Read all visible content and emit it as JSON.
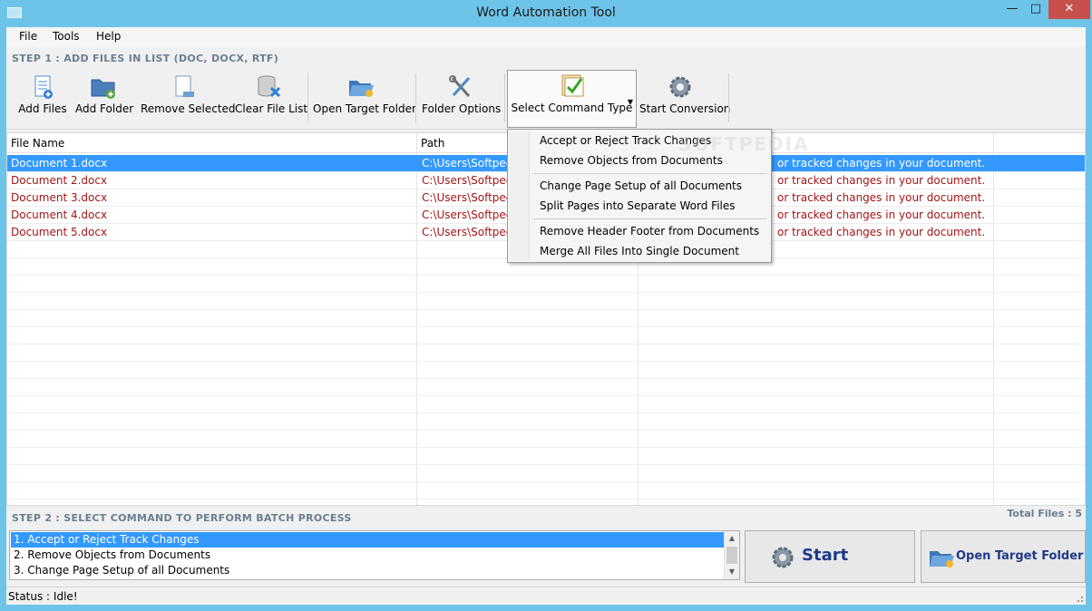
{
  "window": {
    "title": "Word Automation Tool",
    "minimize": "—",
    "maximize": "□",
    "close": "✕"
  },
  "menu": {
    "items": [
      "File",
      "Tools",
      "Help"
    ]
  },
  "step1_label": "STEP 1 : ADD FILES IN LIST (DOC, DOCX, RTF)",
  "toolbar": {
    "add_files": "Add Files",
    "add_folder": "Add Folder",
    "remove_selected": "Remove Selected",
    "clear_file_list": "Clear File List",
    "open_target_folder": "Open Target Folder",
    "folder_options": "Folder Options",
    "select_command_type": "Select Command Type",
    "start_conversion": "Start Conversion"
  },
  "grid": {
    "columns": [
      "File Name",
      "Path"
    ],
    "rows": [
      {
        "name": "Document 1.docx",
        "path": "C:\\Users\\Softpedia",
        "desc": "or tracked changes in your document."
      },
      {
        "name": "Document 2.docx",
        "path": "C:\\Users\\Softpedia",
        "desc": "or tracked changes in your document."
      },
      {
        "name": "Document 3.docx",
        "path": "C:\\Users\\Softpedia",
        "desc": "or tracked changes in your document."
      },
      {
        "name": "Document 4.docx",
        "path": "C:\\Users\\Softpedia",
        "desc": "or tracked changes in your document."
      },
      {
        "name": "Document 5.docx",
        "path": "C:\\Users\\Softpedia",
        "desc": "or tracked changes in your document."
      }
    ]
  },
  "dropdown": {
    "items": [
      "Accept or Reject Track Changes",
      "Remove Objects from Documents",
      "Change Page Setup of all Documents",
      "Split Pages into Separate Word Files",
      "Remove Header  Footer from Documents",
      "Merge All Files Into Single Document"
    ]
  },
  "watermark": "SOFTPEDIA",
  "step2_label": "STEP 2 : SELECT COMMAND TO PERFORM BATCH PROCESS",
  "total_files": "Total Files : 5",
  "command_list": {
    "items": [
      "1. Accept or Reject Track Changes",
      "2. Remove Objects from Documents",
      "3. Change Page Setup of all Documents"
    ],
    "selected_index": 0
  },
  "buttons": {
    "start": "Start",
    "open_target_folder": "Open Target Folder"
  },
  "status": {
    "text": "Status  :  Idle!"
  },
  "colors": {
    "title_bar": "#6ec4e8",
    "selection": "#3399ff",
    "file_text": "#a31515",
    "step_label": "#6b7f90",
    "button_text": "#1f3a8a"
  }
}
